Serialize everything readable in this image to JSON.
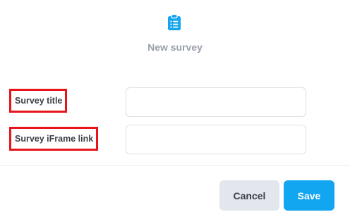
{
  "dialog": {
    "icon": "clipboard-list-icon",
    "title": "New survey"
  },
  "form": {
    "fields": [
      {
        "label": "Survey title",
        "value": "",
        "placeholder": ""
      },
      {
        "label": "Survey iFrame link",
        "value": "",
        "placeholder": ""
      }
    ]
  },
  "actions": {
    "cancel_label": "Cancel",
    "save_label": "Save"
  },
  "colors": {
    "accent": "#12a5f0",
    "highlight_border": "#e8131b",
    "title_text": "#9aa0ab",
    "cancel_bg": "#e4e6ee"
  }
}
